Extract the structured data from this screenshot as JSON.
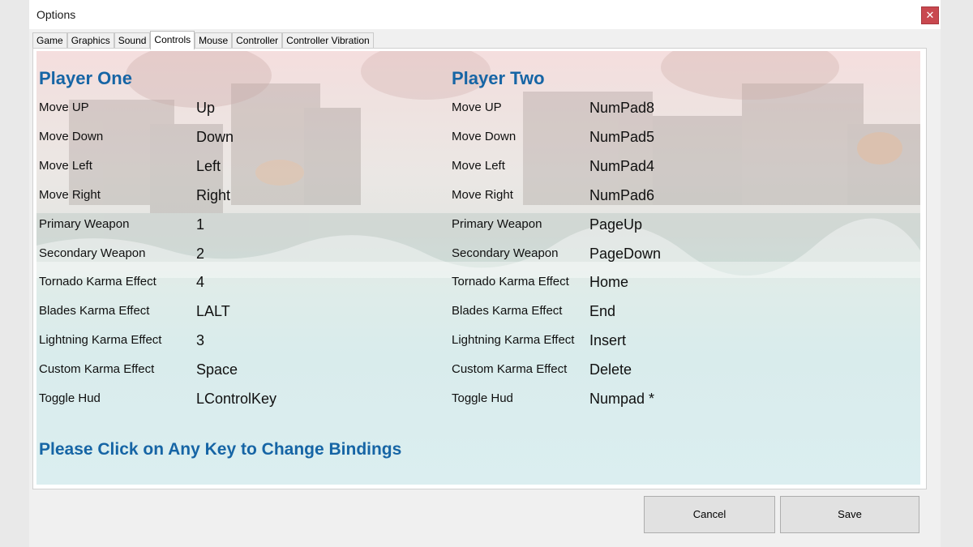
{
  "window": {
    "title": "Options",
    "close_glyph": "✕"
  },
  "tabs": [
    {
      "label": "Game"
    },
    {
      "label": "Graphics"
    },
    {
      "label": "Sound"
    },
    {
      "label": "Controls",
      "active": true
    },
    {
      "label": "Mouse"
    },
    {
      "label": "Controller"
    },
    {
      "label": "Controller Vibration"
    }
  ],
  "player_one": {
    "heading": "Player One",
    "bindings": [
      {
        "action": "Move UP",
        "key": "Up"
      },
      {
        "action": "Move Down",
        "key": "Down"
      },
      {
        "action": "Move Left",
        "key": "Left"
      },
      {
        "action": "Move Right",
        "key": "Right"
      },
      {
        "action": "Primary Weapon",
        "key": "1"
      },
      {
        "action": "Secondary Weapon",
        "key": "2"
      },
      {
        "action": "Tornado Karma Effect",
        "key": "4"
      },
      {
        "action": "Blades Karma Effect",
        "key": "LALT"
      },
      {
        "action": "Lightning Karma Effect",
        "key": "3"
      },
      {
        "action": "Custom Karma Effect",
        "key": "Space"
      },
      {
        "action": "Toggle Hud",
        "key": "LControlKey"
      }
    ]
  },
  "player_two": {
    "heading": "Player Two",
    "bindings": [
      {
        "action": "Move UP",
        "key": "NumPad8"
      },
      {
        "action": "Move Down",
        "key": "NumPad5"
      },
      {
        "action": "Move Left",
        "key": "NumPad4"
      },
      {
        "action": "Move Right",
        "key": "NumPad6"
      },
      {
        "action": "Primary Weapon",
        "key": "PageUp"
      },
      {
        "action": "Secondary Weapon",
        "key": "PageDown"
      },
      {
        "action": "Tornado Karma Effect",
        "key": "Home"
      },
      {
        "action": "Blades Karma Effect",
        "key": "End"
      },
      {
        "action": "Lightning Karma Effect",
        "key": "Insert"
      },
      {
        "action": "Custom Karma Effect",
        "key": "Delete"
      },
      {
        "action": "Toggle Hud",
        "key": "Numpad *"
      }
    ]
  },
  "hint": "Please Click on Any Key to Change Bindings",
  "buttons": {
    "cancel": "Cancel",
    "save": "Save"
  },
  "colors": {
    "heading": "#1665a5",
    "close": "#c9484f"
  }
}
